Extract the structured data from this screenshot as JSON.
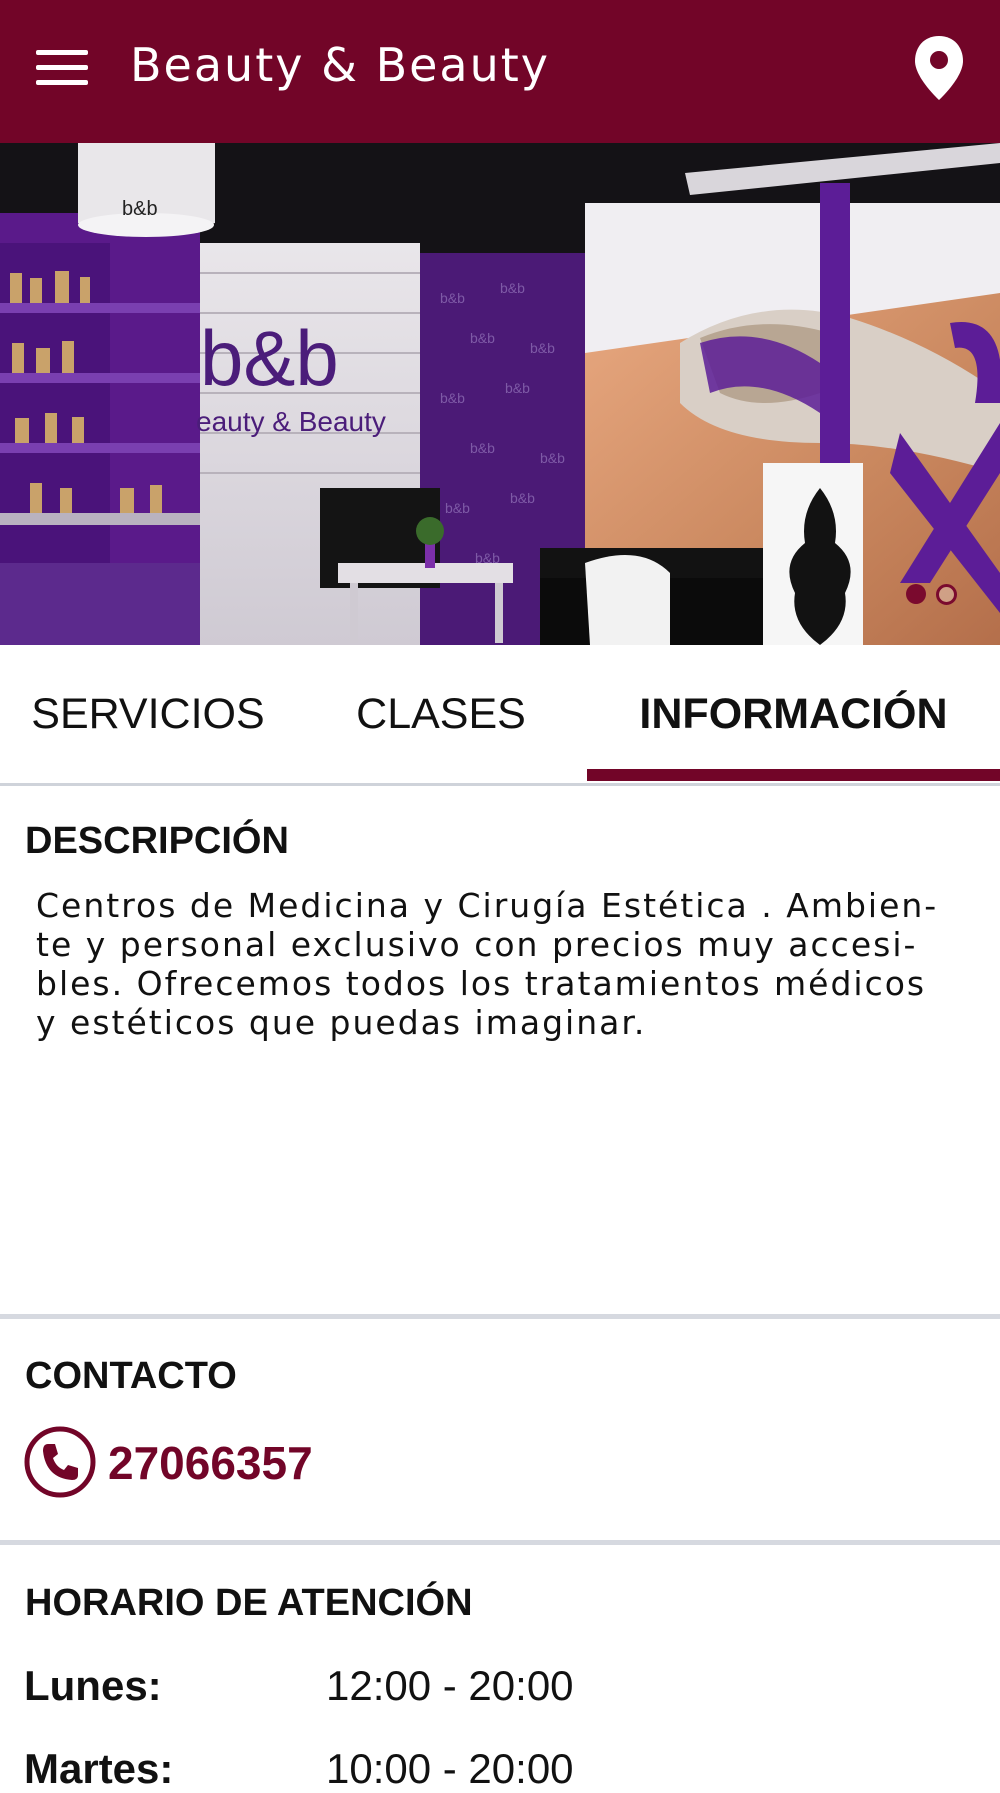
{
  "header": {
    "title": "Beauty & Beauty",
    "menu_icon": "hamburger-menu-icon",
    "location_icon": "map-pin-icon"
  },
  "hero": {
    "slides_total": 2,
    "active_slide": 1,
    "logo_text": "b&b",
    "logo_subtext": "Beauty & Beauty"
  },
  "tabs": [
    {
      "label": "SERVICIOS",
      "active": false
    },
    {
      "label": "CLASES",
      "active": false
    },
    {
      "label": "INFORMACIÓN",
      "active": true
    }
  ],
  "description": {
    "title": "DESCRIPCIÓN",
    "lines": [
      "Centros de Medicina y Cirugía Estética . Ambien-",
      "te y personal exclusivo con precios muy accesi-",
      "bles. Ofrecemos todos los tratamientos médicos",
      "y estéticos que puedas imaginar."
    ]
  },
  "contact": {
    "title": "CONTACTO",
    "phone": "27066357",
    "phone_icon": "phone-icon"
  },
  "hours": {
    "title": "HORARIO DE ATENCIÓN",
    "rows": [
      {
        "day": "Lunes:",
        "time": "12:00 - 20:00"
      },
      {
        "day": "Martes:",
        "time": "10:00 - 20:00"
      }
    ]
  },
  "colors": {
    "brand": "#720528",
    "divider": "#d6d9e0",
    "accent_purple": "#5a1a8a"
  }
}
